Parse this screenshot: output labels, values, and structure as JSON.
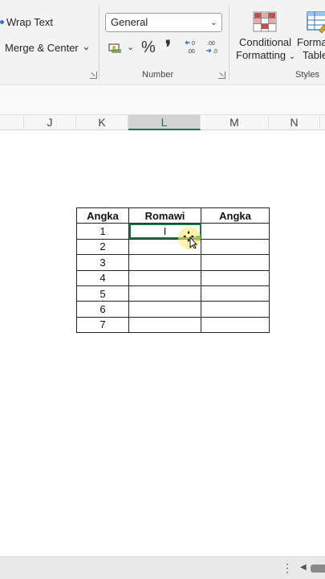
{
  "ribbon": {
    "wrap_text": "Wrap Text",
    "merge_center": "Merge & Center",
    "merge_chevron": "⌄",
    "number_format_value": "General",
    "percent_symbol": "%",
    "comma_symbol": "❜",
    "number_group_label": "Number",
    "conditional_formatting_line1": "Conditional",
    "conditional_formatting_line2": "Formatting",
    "format_table_line1": "Format",
    "format_table_line2": "Table",
    "styles_group_label": "Styles"
  },
  "columns": [
    "J",
    "K",
    "L",
    "M",
    "N"
  ],
  "table": {
    "headers": [
      "Angka",
      "Romawi",
      "Angka"
    ],
    "rows": [
      [
        "1",
        "I",
        ""
      ],
      [
        "2",
        "",
        ""
      ],
      [
        "3",
        "",
        ""
      ],
      [
        "4",
        "",
        ""
      ],
      [
        "5",
        "",
        ""
      ],
      [
        "6",
        "",
        ""
      ],
      [
        "7",
        "",
        ""
      ]
    ]
  },
  "colors": {
    "accent_green": "#217346",
    "ribbon_bg": "#f3f3f3",
    "cf_red": "#c0504d",
    "table_blue": "#2e75b6"
  }
}
